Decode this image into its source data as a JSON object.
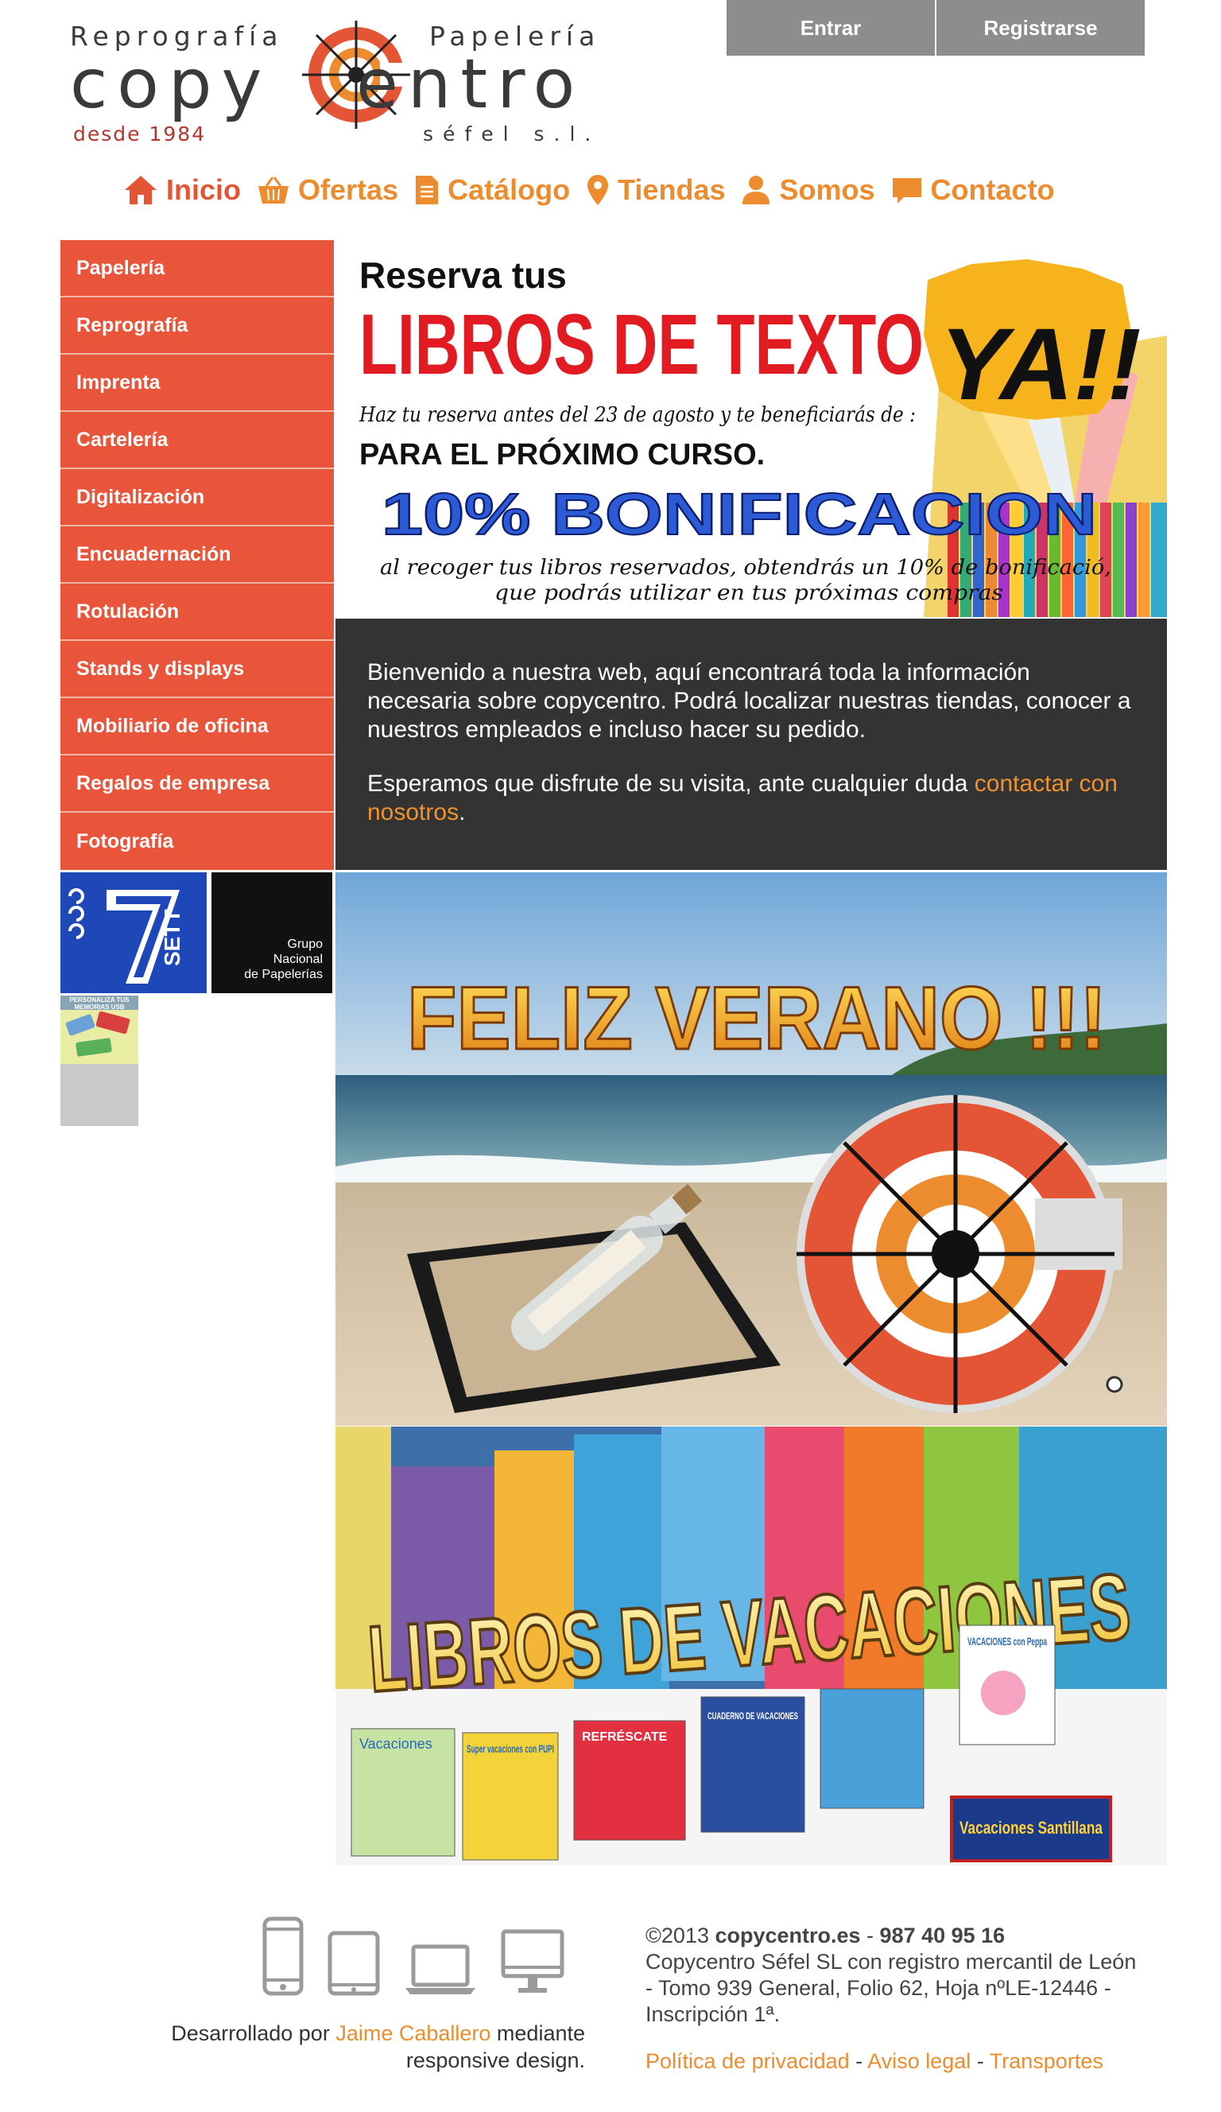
{
  "header": {
    "logo": {
      "top_left": "Reprografía",
      "top_right": "Papelería",
      "brand": "copyCentro",
      "since": "desde 1984",
      "company": "séfel s.l."
    },
    "auth": {
      "login": "Entrar",
      "register": "Registrarse"
    },
    "nav": [
      {
        "label": "Inicio",
        "icon": "home-icon",
        "active": true
      },
      {
        "label": "Ofertas",
        "icon": "basket-icon"
      },
      {
        "label": "Catálogo",
        "icon": "document-icon"
      },
      {
        "label": "Tiendas",
        "icon": "map-pin-icon"
      },
      {
        "label": "Somos",
        "icon": "person-icon"
      },
      {
        "label": "Contacto",
        "icon": "chat-icon"
      }
    ]
  },
  "sidebar": {
    "categories": [
      "Papelería",
      "Reprografía",
      "Imprenta",
      "Cartelería",
      "Digitalización",
      "Encuadernación",
      "Rotulación",
      "Stands y displays",
      "Mobiliario de oficina",
      "Regalos de empresa",
      "Fotografía"
    ],
    "partners": {
      "sett": "SETT",
      "grupo_lines": [
        "Grupo",
        "Nacional",
        "de Papelerías"
      ]
    },
    "usb_banner": "PERSONALIZA TUS MEMORIAS USB"
  },
  "banner_libros": {
    "line1": "Reserva tus",
    "line2": "LIBROS DE TEXTO",
    "ya": "YA!!",
    "line3": "Haz tu reserva antes del 23 de agosto y te beneficiarás de :",
    "line4": "PARA EL PRÓXIMO CURSO.",
    "line5": "10% BONIFICACION",
    "line6a": "al recoger tus libros reservados, obtendrás un 10% de bonificació,",
    "line6b": "que podrás utilizar en tus próximas compras"
  },
  "welcome": {
    "p1": "Bienvenido a nuestra web, aquí encontrará toda la información necesaria sobre copycentro. Podrá localizar nuestras tiendas, conocer a nuestros empleados e incluso hacer su pedido.",
    "p2_prefix": "Esperamos que disfrute de su visita, ante cualquier duda ",
    "p2_link": "contactar con nosotros",
    "p2_suffix": "."
  },
  "slides": {
    "verano": "FELIZ VERANO !!!",
    "vacaciones": "LIBROS DE VACACIONES",
    "book_titles": [
      "Vacaciones",
      "Super vacaciones con PUPI",
      "REFRÉSCATE",
      "CUADERNO DE VACACIONES",
      "VACACIONES con Peppa",
      "Vacaciones Santillana"
    ]
  },
  "footer": {
    "dev_prefix": "Desarrollado por ",
    "dev_link": "Jaime Caballero",
    "dev_suffix": " mediante responsive design.",
    "copyright": "©2013 ",
    "domain": "copycentro.es",
    "sep": " - ",
    "phone": "987 40 95 16",
    "registry": "Copycentro Séfel SL con registro mercantil de León - Tomo 939 General, Folio 62, Hoja nºLE-12446 - Inscripción 1ª.",
    "links": [
      "Política de privacidad",
      "Aviso legal",
      "Transportes"
    ],
    "link_sep": " - "
  },
  "colors": {
    "brand_orange": "#ec8c2e",
    "brand_red": "#e8553a",
    "dark_panel": "#333333",
    "auth_button": "#8d8d8d"
  }
}
